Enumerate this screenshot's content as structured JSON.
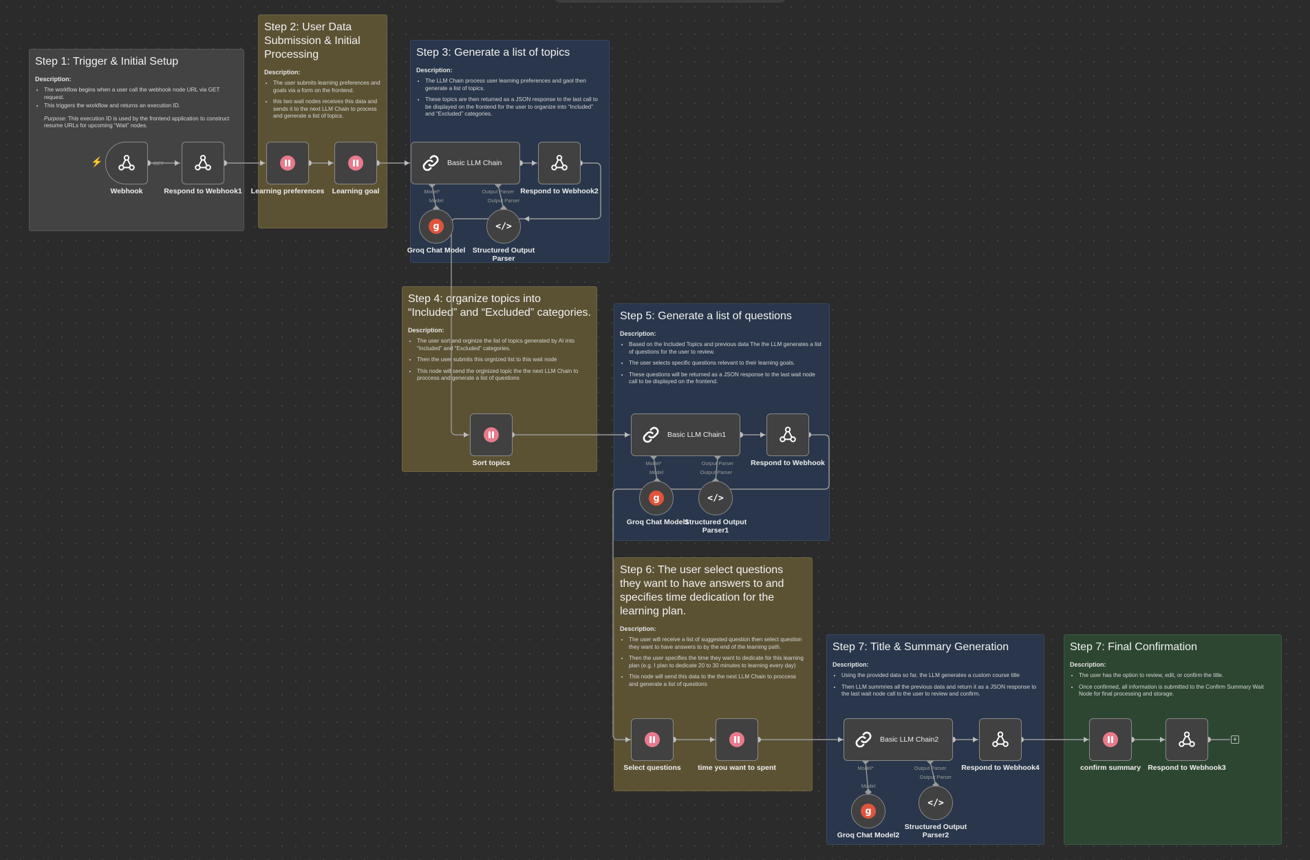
{
  "notes": {
    "step1": {
      "title": "Step 1: Trigger & Initial Setup",
      "desc": "Description:",
      "items": [
        "The workflow begins when a user call the webhook node URL via GET request.",
        "This triggers the workflow and returns an execution ID."
      ],
      "purpose_label": "Purpose:",
      "purpose_text": " This execution ID is used by the frontend application to construct resume URLs for upcoming “Wait” nodes."
    },
    "step2": {
      "title": "Step 2: User Data Submission & Initial Processing",
      "desc": "Description:",
      "items": [
        "The user submits learning preferences and goals via a form on the frontend.",
        "this two wait nodes receives this data and sends it to the next LLM Chain to process and generate a list of topics."
      ]
    },
    "step3": {
      "title": "Step 3: Generate a list of topics",
      "desc": "Description:",
      "items": [
        "The LLM Chain process user learning preferences and gaol then generate a list of topics.",
        "These topics are then returned as a JSON response to the last call to be displayed on the frontend for the user to organize into “Included” and “Excluded” categories."
      ]
    },
    "step4": {
      "title": "Step 4: organize topics into “Included” and “Excluded” categories.",
      "desc": "Description:",
      "items": [
        "The user sort and orginize the list of topics generated by AI into “Included” and “Excluded” categories.",
        "Then the user submits this orgnized list to this wait node",
        "This node will send the orginized topic the the next LLM Chain to proccess and generate a list of questions"
      ]
    },
    "step5": {
      "title": "Step 5: Generate a list of questions",
      "desc": "Description:",
      "items": [
        "Based on the Included Topics and previous data The the LLM generates a list of questions for the user to review.",
        "The user selects specific questions relevant to their learning goals.",
        "These questions will be returned as a JSON response to the last wait node call to be displayed on the frontend."
      ]
    },
    "step6": {
      "title": "Step 6: The user select questions they want to have answers to and specifies time dedication for the learning plan.",
      "desc": "Description:",
      "items": [
        "The user will receive a list of suggested question then select question they want to have answers to by the end of the learning path.",
        "Then the user specifies the time they want to dedicate for this learning plan (e.g. I plan to dedicate 20 to 30 minutes to learning every day)",
        "This node will send this data to the the next LLM Chain to proccess and generate a list of questions"
      ]
    },
    "step7a": {
      "title": "Step 7: Title & Summary Generation",
      "desc": "Description:",
      "items": [
        "Using the provided data so far, the LLM generates a custom course title",
        "Then LLM summries all the previous data and return it as a JSON response to the last wait node call to the user to review and confirm."
      ]
    },
    "step7b": {
      "title": "Step 7: Final Confirmation",
      "desc": "Description:",
      "items": [
        "The user has the option to review, edit, or confirm the title.",
        "Once confirmed, all information is submitted to the Confirm Summary Wait Node for final processing and storage."
      ]
    }
  },
  "nodes": {
    "webhook": "Webhook",
    "get_label": "GET",
    "respond1": "Respond to Webhook1",
    "learning_prefs": "Learning preferences",
    "learning_goal": "Learning goal",
    "llm_chain": "Basic LLM Chain",
    "respond2": "Respond to Webhook2",
    "groq": "Groq Chat Model",
    "parser": "Structured Output Parser",
    "sort_topics": "Sort topics",
    "llm_chain1": "Basic LLM Chain1",
    "respond": "Respond to Webhook",
    "groq1": "Groq Chat Model1",
    "parser1": "Structured Output Parser1",
    "select_questions": "Select questions",
    "time_spent": "time you want to spent",
    "llm_chain2": "Basic LLM Chain2",
    "respond4": "Respond to Webhook4",
    "groq2": "Groq Chat Model2",
    "parser2": "Structured Output Parser2",
    "confirm_summary": "confirm summary",
    "respond3": "Respond to Webhook3"
  },
  "ports": {
    "model_req": "Model*",
    "model": "Model",
    "output_parser": "Output Parser"
  },
  "icons": {
    "webhook": "webhook-icon",
    "wait": "pause-icon",
    "chain": "link-icon",
    "groq": "groq-icon",
    "parser": "code-icon",
    "trigger": "lightning-icon",
    "add": "plus-icon"
  },
  "colors": {
    "note_gray": "#434343",
    "note_yellow": "#5b5234",
    "note_blue": "#29364b",
    "note_green": "#2d4632",
    "wait_icon": "#e87a8c",
    "groq_icon": "#e0533d",
    "trigger_icon": "#ff6d3f"
  }
}
